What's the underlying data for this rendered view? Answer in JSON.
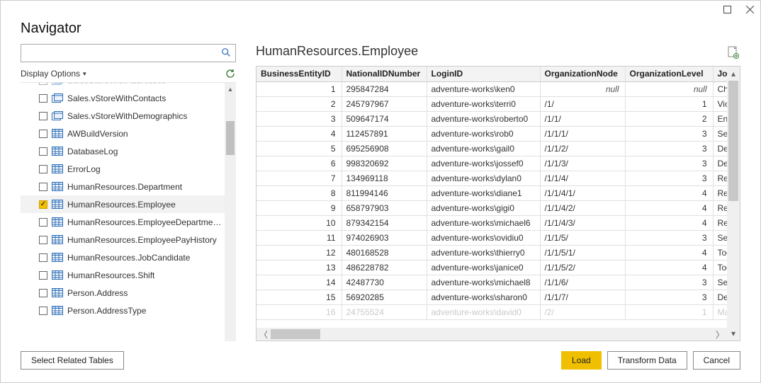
{
  "window": {
    "title": "Navigator"
  },
  "sidebar": {
    "display_options_label": "Display Options",
    "items": [
      {
        "label": "SalesStoreWithAddresses",
        "icon": "view",
        "checked": false,
        "cut": true
      },
      {
        "label": "Sales.vStoreWithContacts",
        "icon": "view",
        "checked": false
      },
      {
        "label": "Sales.vStoreWithDemographics",
        "icon": "view",
        "checked": false
      },
      {
        "label": "AWBuildVersion",
        "icon": "table",
        "checked": false
      },
      {
        "label": "DatabaseLog",
        "icon": "table",
        "checked": false
      },
      {
        "label": "ErrorLog",
        "icon": "table",
        "checked": false
      },
      {
        "label": "HumanResources.Department",
        "icon": "table",
        "checked": false
      },
      {
        "label": "HumanResources.Employee",
        "icon": "table",
        "checked": true,
        "selected": true
      },
      {
        "label": "HumanResources.EmployeeDepartmen...",
        "icon": "table",
        "checked": false
      },
      {
        "label": "HumanResources.EmployeePayHistory",
        "icon": "table",
        "checked": false
      },
      {
        "label": "HumanResources.JobCandidate",
        "icon": "table",
        "checked": false
      },
      {
        "label": "HumanResources.Shift",
        "icon": "table",
        "checked": false
      },
      {
        "label": "Person.Address",
        "icon": "table",
        "checked": false
      },
      {
        "label": "Person.AddressType",
        "icon": "table",
        "checked": false
      }
    ]
  },
  "preview": {
    "title": "HumanResources.Employee",
    "columns": [
      "BusinessEntityID",
      "NationalIDNumber",
      "LoginID",
      "OrganizationNode",
      "OrganizationLevel",
      "JobTitle"
    ],
    "rows": [
      {
        "be": "1",
        "nid": "295847284",
        "login": "adventure-works\\ken0",
        "org": null,
        "lvl": null,
        "job": "Chie"
      },
      {
        "be": "2",
        "nid": "245797967",
        "login": "adventure-works\\terri0",
        "org": "/1/",
        "lvl": "1",
        "job": "Vice"
      },
      {
        "be": "3",
        "nid": "509647174",
        "login": "adventure-works\\roberto0",
        "org": "/1/1/",
        "lvl": "2",
        "job": "Eng"
      },
      {
        "be": "4",
        "nid": "112457891",
        "login": "adventure-works\\rob0",
        "org": "/1/1/1/",
        "lvl": "3",
        "job": "Sen"
      },
      {
        "be": "5",
        "nid": "695256908",
        "login": "adventure-works\\gail0",
        "org": "/1/1/2/",
        "lvl": "3",
        "job": "Des"
      },
      {
        "be": "6",
        "nid": "998320692",
        "login": "adventure-works\\jossef0",
        "org": "/1/1/3/",
        "lvl": "3",
        "job": "Des"
      },
      {
        "be": "7",
        "nid": "134969118",
        "login": "adventure-works\\dylan0",
        "org": "/1/1/4/",
        "lvl": "3",
        "job": "Res"
      },
      {
        "be": "8",
        "nid": "811994146",
        "login": "adventure-works\\diane1",
        "org": "/1/1/4/1/",
        "lvl": "4",
        "job": "Res"
      },
      {
        "be": "9",
        "nid": "658797903",
        "login": "adventure-works\\gigi0",
        "org": "/1/1/4/2/",
        "lvl": "4",
        "job": "Res"
      },
      {
        "be": "10",
        "nid": "879342154",
        "login": "adventure-works\\michael6",
        "org": "/1/1/4/3/",
        "lvl": "4",
        "job": "Res"
      },
      {
        "be": "11",
        "nid": "974026903",
        "login": "adventure-works\\ovidiu0",
        "org": "/1/1/5/",
        "lvl": "3",
        "job": "Sen"
      },
      {
        "be": "12",
        "nid": "480168528",
        "login": "adventure-works\\thierry0",
        "org": "/1/1/5/1/",
        "lvl": "4",
        "job": "Too"
      },
      {
        "be": "13",
        "nid": "486228782",
        "login": "adventure-works\\janice0",
        "org": "/1/1/5/2/",
        "lvl": "4",
        "job": "Too"
      },
      {
        "be": "14",
        "nid": "42487730",
        "login": "adventure-works\\michael8",
        "org": "/1/1/6/",
        "lvl": "3",
        "job": "Sen"
      },
      {
        "be": "15",
        "nid": "56920285",
        "login": "adventure-works\\sharon0",
        "org": "/1/1/7/",
        "lvl": "3",
        "job": "Des"
      },
      {
        "be": "16",
        "nid": "24755524",
        "login": "adventure-works\\david0",
        "org": "/2/",
        "lvl": "1",
        "job": "Ma",
        "cut": true
      }
    ]
  },
  "footer": {
    "select_related": "Select Related Tables",
    "load": "Load",
    "transform": "Transform Data",
    "cancel": "Cancel"
  }
}
